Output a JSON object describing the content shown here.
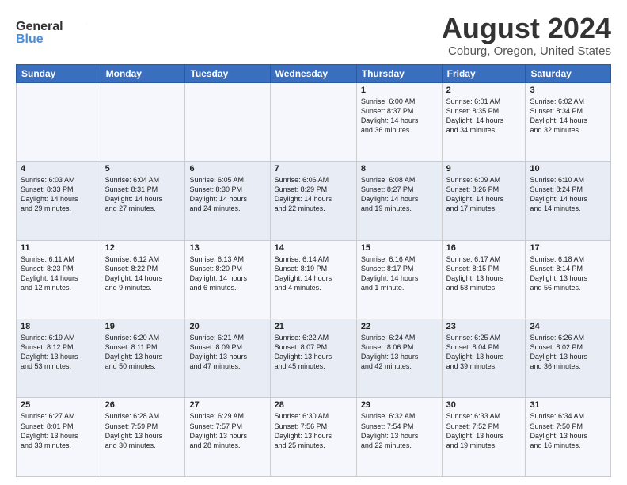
{
  "header": {
    "logo_line1": "General",
    "logo_line2": "Blue",
    "month_title": "August 2024",
    "location": "Coburg, Oregon, United States"
  },
  "weekdays": [
    "Sunday",
    "Monday",
    "Tuesday",
    "Wednesday",
    "Thursday",
    "Friday",
    "Saturday"
  ],
  "weeks": [
    [
      {
        "day": "",
        "info": ""
      },
      {
        "day": "",
        "info": ""
      },
      {
        "day": "",
        "info": ""
      },
      {
        "day": "",
        "info": ""
      },
      {
        "day": "1",
        "info": "Sunrise: 6:00 AM\nSunset: 8:37 PM\nDaylight: 14 hours\nand 36 minutes."
      },
      {
        "day": "2",
        "info": "Sunrise: 6:01 AM\nSunset: 8:35 PM\nDaylight: 14 hours\nand 34 minutes."
      },
      {
        "day": "3",
        "info": "Sunrise: 6:02 AM\nSunset: 8:34 PM\nDaylight: 14 hours\nand 32 minutes."
      }
    ],
    [
      {
        "day": "4",
        "info": "Sunrise: 6:03 AM\nSunset: 8:33 PM\nDaylight: 14 hours\nand 29 minutes."
      },
      {
        "day": "5",
        "info": "Sunrise: 6:04 AM\nSunset: 8:31 PM\nDaylight: 14 hours\nand 27 minutes."
      },
      {
        "day": "6",
        "info": "Sunrise: 6:05 AM\nSunset: 8:30 PM\nDaylight: 14 hours\nand 24 minutes."
      },
      {
        "day": "7",
        "info": "Sunrise: 6:06 AM\nSunset: 8:29 PM\nDaylight: 14 hours\nand 22 minutes."
      },
      {
        "day": "8",
        "info": "Sunrise: 6:08 AM\nSunset: 8:27 PM\nDaylight: 14 hours\nand 19 minutes."
      },
      {
        "day": "9",
        "info": "Sunrise: 6:09 AM\nSunset: 8:26 PM\nDaylight: 14 hours\nand 17 minutes."
      },
      {
        "day": "10",
        "info": "Sunrise: 6:10 AM\nSunset: 8:24 PM\nDaylight: 14 hours\nand 14 minutes."
      }
    ],
    [
      {
        "day": "11",
        "info": "Sunrise: 6:11 AM\nSunset: 8:23 PM\nDaylight: 14 hours\nand 12 minutes."
      },
      {
        "day": "12",
        "info": "Sunrise: 6:12 AM\nSunset: 8:22 PM\nDaylight: 14 hours\nand 9 minutes."
      },
      {
        "day": "13",
        "info": "Sunrise: 6:13 AM\nSunset: 8:20 PM\nDaylight: 14 hours\nand 6 minutes."
      },
      {
        "day": "14",
        "info": "Sunrise: 6:14 AM\nSunset: 8:19 PM\nDaylight: 14 hours\nand 4 minutes."
      },
      {
        "day": "15",
        "info": "Sunrise: 6:16 AM\nSunset: 8:17 PM\nDaylight: 14 hours\nand 1 minute."
      },
      {
        "day": "16",
        "info": "Sunrise: 6:17 AM\nSunset: 8:15 PM\nDaylight: 13 hours\nand 58 minutes."
      },
      {
        "day": "17",
        "info": "Sunrise: 6:18 AM\nSunset: 8:14 PM\nDaylight: 13 hours\nand 56 minutes."
      }
    ],
    [
      {
        "day": "18",
        "info": "Sunrise: 6:19 AM\nSunset: 8:12 PM\nDaylight: 13 hours\nand 53 minutes."
      },
      {
        "day": "19",
        "info": "Sunrise: 6:20 AM\nSunset: 8:11 PM\nDaylight: 13 hours\nand 50 minutes."
      },
      {
        "day": "20",
        "info": "Sunrise: 6:21 AM\nSunset: 8:09 PM\nDaylight: 13 hours\nand 47 minutes."
      },
      {
        "day": "21",
        "info": "Sunrise: 6:22 AM\nSunset: 8:07 PM\nDaylight: 13 hours\nand 45 minutes."
      },
      {
        "day": "22",
        "info": "Sunrise: 6:24 AM\nSunset: 8:06 PM\nDaylight: 13 hours\nand 42 minutes."
      },
      {
        "day": "23",
        "info": "Sunrise: 6:25 AM\nSunset: 8:04 PM\nDaylight: 13 hours\nand 39 minutes."
      },
      {
        "day": "24",
        "info": "Sunrise: 6:26 AM\nSunset: 8:02 PM\nDaylight: 13 hours\nand 36 minutes."
      }
    ],
    [
      {
        "day": "25",
        "info": "Sunrise: 6:27 AM\nSunset: 8:01 PM\nDaylight: 13 hours\nand 33 minutes."
      },
      {
        "day": "26",
        "info": "Sunrise: 6:28 AM\nSunset: 7:59 PM\nDaylight: 13 hours\nand 30 minutes."
      },
      {
        "day": "27",
        "info": "Sunrise: 6:29 AM\nSunset: 7:57 PM\nDaylight: 13 hours\nand 28 minutes."
      },
      {
        "day": "28",
        "info": "Sunrise: 6:30 AM\nSunset: 7:56 PM\nDaylight: 13 hours\nand 25 minutes."
      },
      {
        "day": "29",
        "info": "Sunrise: 6:32 AM\nSunset: 7:54 PM\nDaylight: 13 hours\nand 22 minutes."
      },
      {
        "day": "30",
        "info": "Sunrise: 6:33 AM\nSunset: 7:52 PM\nDaylight: 13 hours\nand 19 minutes."
      },
      {
        "day": "31",
        "info": "Sunrise: 6:34 AM\nSunset: 7:50 PM\nDaylight: 13 hours\nand 16 minutes."
      }
    ]
  ]
}
